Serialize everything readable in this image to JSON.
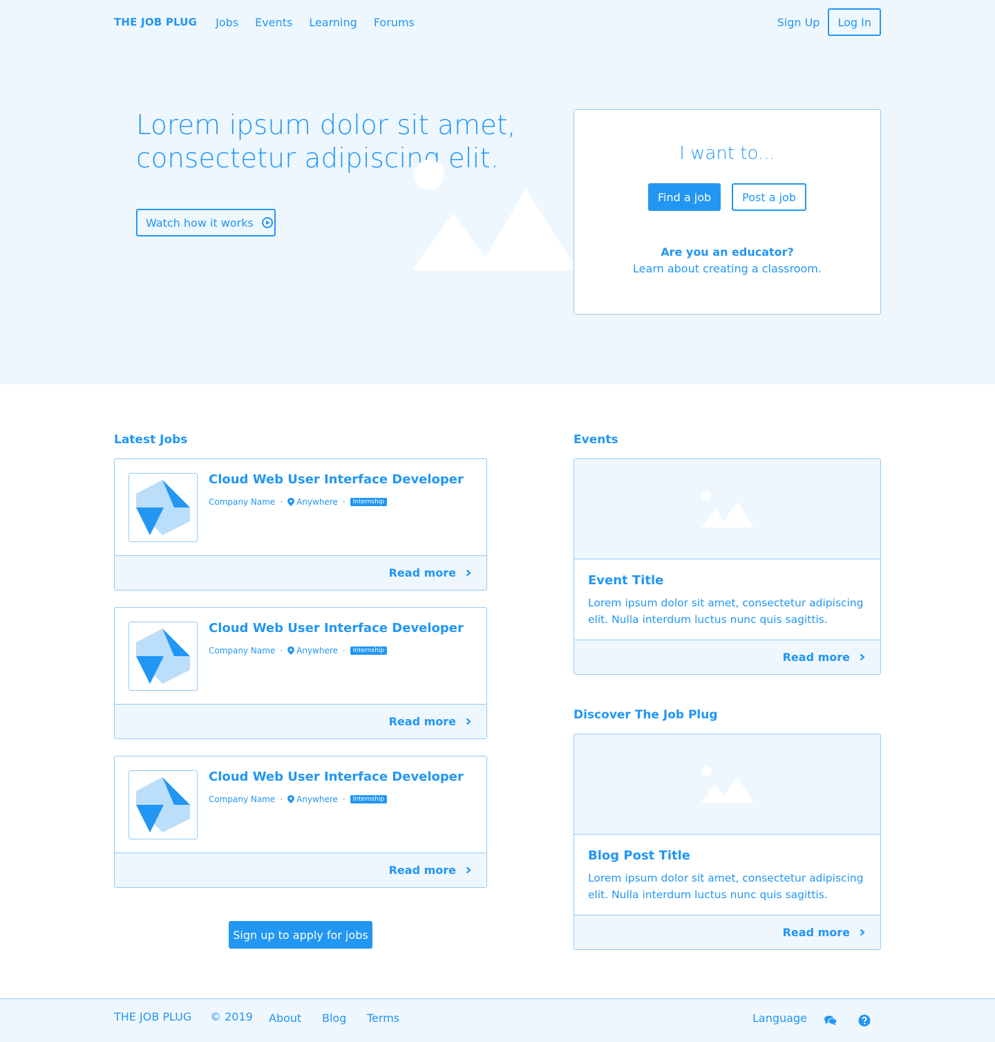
{
  "nav": {
    "brand": "THE JOB PLUG",
    "links": [
      "Jobs",
      "Events",
      "Learning",
      "Forums"
    ],
    "sign_up": "Sign Up",
    "log_in": "Log In"
  },
  "hero": {
    "title": "Lorem ipsum dolor sit amet, consectetur adipiscing elit.",
    "watch_button": "Watch how it works"
  },
  "want_card": {
    "title": "I want to...",
    "find_job": "Find a job",
    "post_job": "Post a job",
    "educator_question": "Are you an educator?",
    "educator_link": "Learn about creating a classroom."
  },
  "latest_jobs": {
    "heading": "Latest Jobs",
    "jobs": [
      {
        "title": "Cloud Web User Interface Developer",
        "company": "Company Name",
        "location": "Anywhere",
        "badge": "Internship",
        "read_more": "Read more"
      },
      {
        "title": "Cloud Web User Interface Developer",
        "company": "Company Name",
        "location": "Anywhere",
        "badge": "Internship",
        "read_more": "Read more"
      },
      {
        "title": "Cloud Web User Interface Developer",
        "company": "Company Name",
        "location": "Anywhere",
        "badge": "Internship",
        "read_more": "Read more"
      }
    ],
    "apply_button": "Sign up to apply for jobs"
  },
  "events": {
    "heading": "Events",
    "title": "Event Title",
    "text": "Lorem ipsum dolor sit amet, consectetur adipiscing elit. Nulla interdum luctus nunc quis sagittis.",
    "read_more": "Read more"
  },
  "discover": {
    "heading": "Discover The Job Plug",
    "title": "Blog Post Title",
    "text": "Lorem ipsum dolor sit amet, consectetur adipiscing elit. Nulla interdum luctus nunc quis sagittis.",
    "read_more": "Read more"
  },
  "footer": {
    "brand": "THE JOB PLUG",
    "copyright": "© 2019",
    "links": [
      "About",
      "Blog",
      "Terms"
    ],
    "language": "Language"
  },
  "colors": {
    "accent": "#2196f3",
    "light_bg": "#eff7fe",
    "border": "#90caf9"
  },
  "icons": [
    "play-circle-icon",
    "map-pin-icon",
    "chevron-right-icon",
    "image-placeholder-icon",
    "chat-icon",
    "help-icon"
  ]
}
